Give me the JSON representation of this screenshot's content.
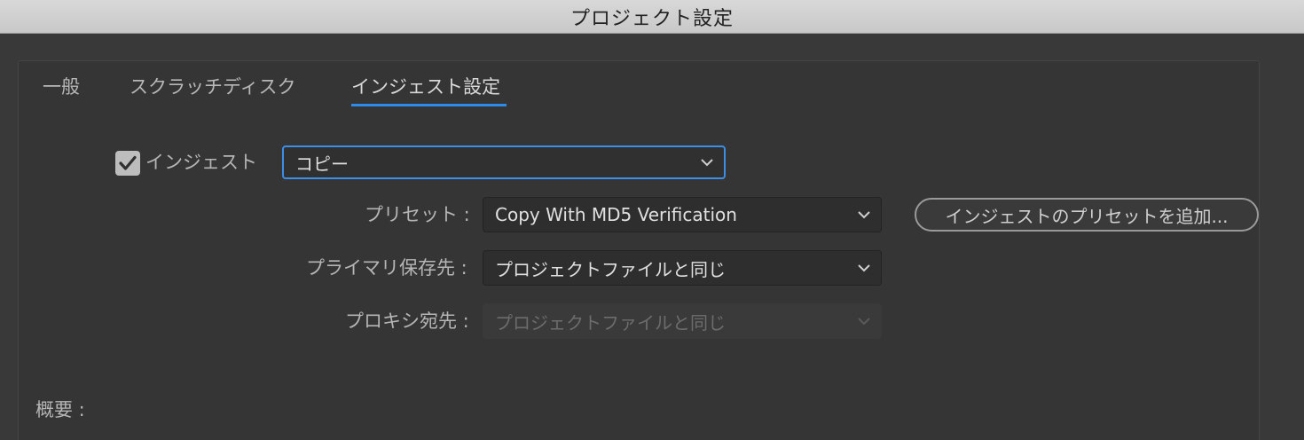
{
  "window": {
    "title": "プロジェクト設定"
  },
  "tabs": [
    {
      "label": "一般"
    },
    {
      "label": "スクラッチディスク"
    },
    {
      "label": "インジェスト設定"
    }
  ],
  "ingest": {
    "checkbox_label": "インジェスト",
    "checked": true,
    "mode_value": "コピー"
  },
  "preset": {
    "label": "プリセット :",
    "value": "Copy With MD5 Verification",
    "add_button_label": "インジェストのプリセットを追加..."
  },
  "primary_destination": {
    "label": "プライマリ保存先 :",
    "value": "プロジェクトファイルと同じ"
  },
  "proxy_destination": {
    "label": "プロキシ宛先 :",
    "value": "プロジェクトファイルと同じ",
    "disabled": true
  },
  "summary": {
    "label": "概要 :"
  },
  "colors": {
    "accent": "#2d8ceb",
    "background": "#393939",
    "titlebar": "#d2d1d2"
  },
  "icons": {
    "checkbox": "checkmark-icon",
    "dropdown": "chevron-down-icon"
  }
}
